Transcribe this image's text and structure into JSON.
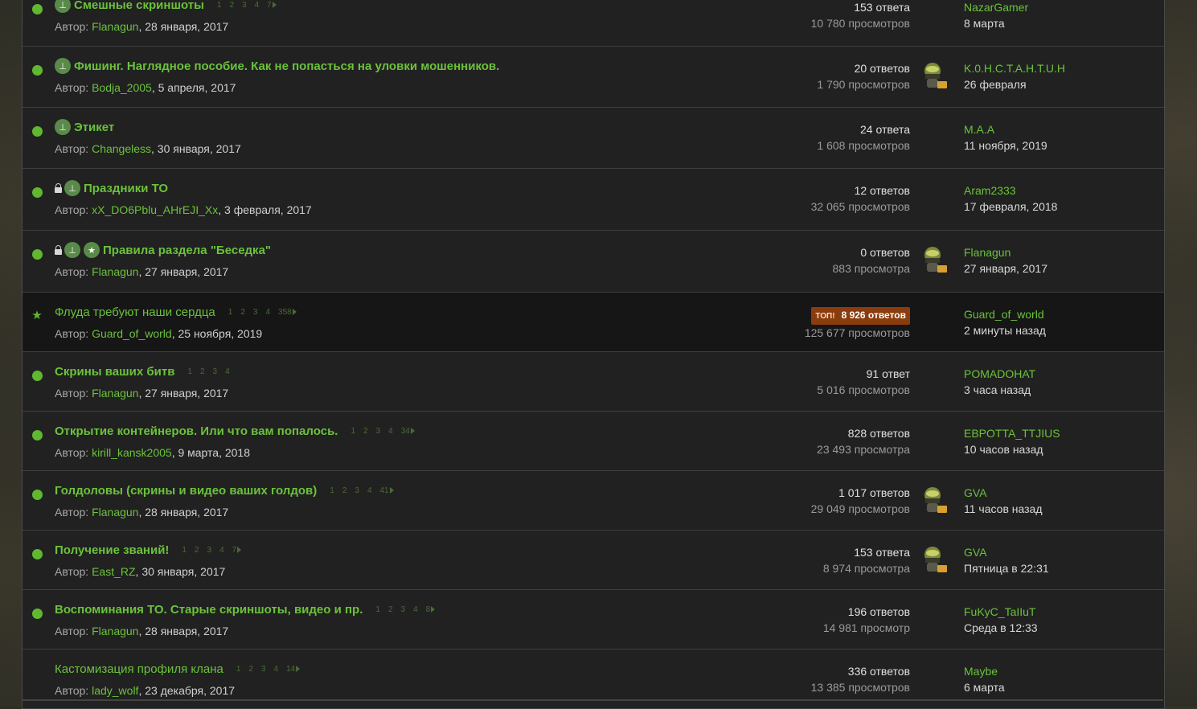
{
  "threads": [
    {
      "status": "dot",
      "lock": false,
      "pin": true,
      "star": false,
      "bold": true,
      "title": "Смешные скриншоты",
      "pages": [
        "1",
        "2",
        "3",
        "4",
        "7"
      ],
      "pages_arrow": true,
      "author_prefix": "Автор: ",
      "author": "Flanagun",
      "date": ", 28 января, 2017",
      "replies": "153 ответа",
      "views": "10 780 просмотров",
      "avatar": false,
      "last_user": "NazarGamer",
      "last_when": "8 марта"
    },
    {
      "status": "dot",
      "lock": false,
      "pin": true,
      "star": false,
      "bold": true,
      "title": "Фишинг. Наглядное пособие. Как не попасться на уловки мошенников.",
      "pages": [],
      "pages_arrow": false,
      "author_prefix": "Автор: ",
      "author": "Bodja_2005",
      "date": ", 5 апреля, 2017",
      "replies": "20 ответов",
      "views": "1 790 просмотров",
      "avatar": true,
      "last_user": "K.0.H.C.T.A.H.T.U.H",
      "last_when": "26 февраля"
    },
    {
      "status": "dot",
      "lock": false,
      "pin": true,
      "star": false,
      "bold": true,
      "title": "Этикет",
      "pages": [],
      "pages_arrow": false,
      "author_prefix": "Автор: ",
      "author": "Changeless",
      "date": ", 30 января, 2017",
      "replies": "24 ответа",
      "views": "1 608 просмотров",
      "avatar": false,
      "last_user": "M.A.A",
      "last_when": "11 ноября, 2019"
    },
    {
      "status": "dot",
      "lock": true,
      "pin": true,
      "star": false,
      "bold": true,
      "title": "Праздники ТО",
      "pages": [],
      "pages_arrow": false,
      "author_prefix": "Автор: ",
      "author": "xX_DO6Pblu_AHrEJI_Xx",
      "date": ", 3 февраля, 2017",
      "replies": "12 ответов",
      "views": "32 065 просмотров",
      "avatar": false,
      "last_user": "Aram2333",
      "last_when": "17 февраля, 2018"
    },
    {
      "status": "dot",
      "lock": true,
      "pin": true,
      "star": true,
      "bold": true,
      "title": "Правила раздела \"Беседка\"",
      "pages": [],
      "pages_arrow": false,
      "author_prefix": "Автор: ",
      "author": "Flanagun",
      "date": ", 27 января, 2017",
      "replies": "0 ответов",
      "views": "883 просмотра",
      "avatar": true,
      "last_user": "Flanagun",
      "last_when": "27 января, 2017"
    },
    {
      "status": "star",
      "lock": false,
      "pin": false,
      "star": false,
      "bold": false,
      "hot": true,
      "title": "Флуда требуют наши сердца",
      "pages": [
        "1",
        "2",
        "3",
        "4",
        "358"
      ],
      "pages_arrow": true,
      "author_prefix": "Автор: ",
      "author": "Guard_of_world",
      "date": ", 25 ноября, 2019",
      "top_tag": "ТОП!",
      "replies": "8 926 ответов",
      "views": "125 677 просмотров",
      "avatar": false,
      "last_user": "Guard_of_world",
      "last_when": "2 минуты назад"
    },
    {
      "status": "dot",
      "lock": false,
      "pin": false,
      "star": false,
      "bold": true,
      "title": "Скрины ваших битв",
      "pages": [
        "1",
        "2",
        "3",
        "4"
      ],
      "pages_arrow": false,
      "author_prefix": "Автор: ",
      "author": "Flanagun",
      "date": ", 27 января, 2017",
      "replies": "91 ответ",
      "views": "5 016 просмотров",
      "avatar": false,
      "last_user": "POMADOHAT",
      "last_when": "3 часа назад"
    },
    {
      "status": "dot",
      "lock": false,
      "pin": false,
      "star": false,
      "bold": true,
      "title": "Открытие контейнеров. Или что вам попалось.",
      "pages": [
        "1",
        "2",
        "3",
        "4",
        "34"
      ],
      "pages_arrow": true,
      "author_prefix": "Автор: ",
      "author": "kirill_kansk2005",
      "date": ", 9 марта, 2018",
      "replies": "828 ответов",
      "views": "23 493 просмотра",
      "avatar": false,
      "last_user": "EBPOTTA_TTJIUS",
      "last_when": "10 часов назад"
    },
    {
      "status": "dot",
      "lock": false,
      "pin": false,
      "star": false,
      "bold": true,
      "title": "Голдоловы (скрины и видео ваших голдов)",
      "pages": [
        "1",
        "2",
        "3",
        "4",
        "41"
      ],
      "pages_arrow": true,
      "author_prefix": "Автор: ",
      "author": "Flanagun",
      "date": ", 28 января, 2017",
      "replies": "1 017 ответов",
      "views": "29 049 просмотров",
      "avatar": true,
      "last_user": "GVA",
      "last_when": "11 часов назад"
    },
    {
      "status": "dot",
      "lock": false,
      "pin": false,
      "star": false,
      "bold": true,
      "title": "Получение званий!",
      "pages": [
        "1",
        "2",
        "3",
        "4",
        "7"
      ],
      "pages_arrow": true,
      "author_prefix": "Автор: ",
      "author": "East_RZ",
      "date": ", 30 января, 2017",
      "replies": "153 ответа",
      "views": "8 974 просмотра",
      "avatar": true,
      "last_user": "GVA",
      "last_when": "Пятница в 22:31"
    },
    {
      "status": "dot",
      "lock": false,
      "pin": false,
      "star": false,
      "bold": true,
      "title": "Воспоминания ТО. Старые скриншоты, видео и пр.",
      "pages": [
        "1",
        "2",
        "3",
        "4",
        "8"
      ],
      "pages_arrow": true,
      "author_prefix": "Автор: ",
      "author": "Flanagun",
      "date": ", 28 января, 2017",
      "replies": "196 ответов",
      "views": "14 981 просмотр",
      "avatar": false,
      "last_user": "FuKyC_TaIIuT",
      "last_when": "Среда в 12:33"
    },
    {
      "status": "none",
      "lock": false,
      "pin": false,
      "star": false,
      "bold": false,
      "title": "Кастомизация профиля клана",
      "pages": [
        "1",
        "2",
        "3",
        "4",
        "14"
      ],
      "pages_arrow": true,
      "author_prefix": "Автор: ",
      "author": "lady_wolf",
      "date": ", 23 декабря, 2017",
      "replies": "336 ответов",
      "views": "13 385 просмотров",
      "avatar": false,
      "last_user": "Maybe",
      "last_when": "6 марта"
    }
  ]
}
